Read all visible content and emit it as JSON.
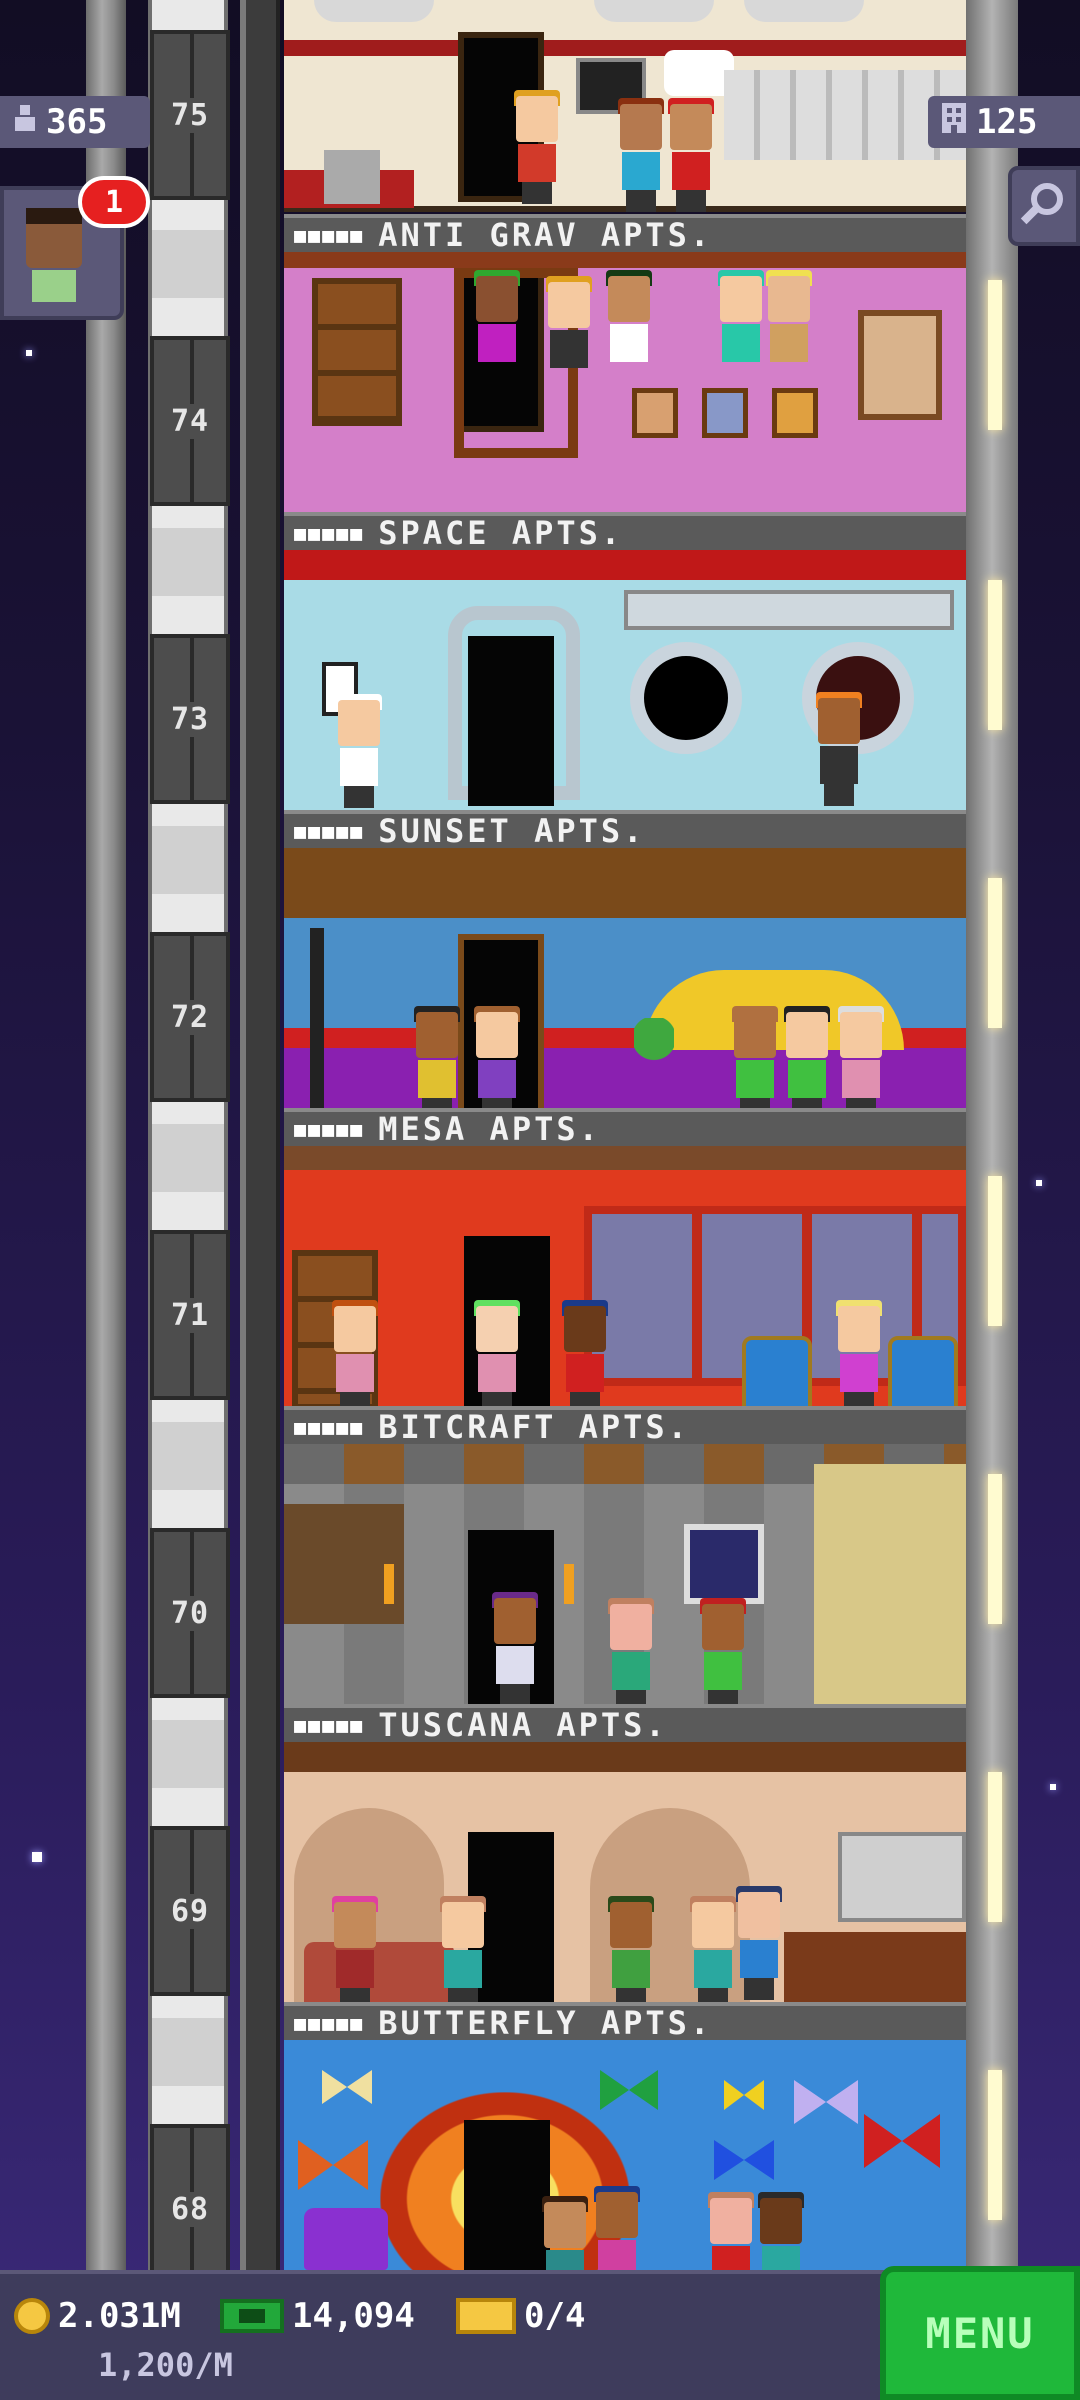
{
  "hud": {
    "population": "365",
    "current_floor": "75",
    "floor_count": "125",
    "notification_count": "1"
  },
  "floors": [
    {
      "number": "75",
      "name": "",
      "stars": ""
    },
    {
      "number": "74",
      "name": "ANTI GRAV APTS.",
      "stars": "■■■■■"
    },
    {
      "number": "73",
      "name": "SPACE APTS.",
      "stars": "■■■■■"
    },
    {
      "number": "72",
      "name": "SUNSET APTS.",
      "stars": "■■■■■"
    },
    {
      "number": "71",
      "name": "MESA APTS.",
      "stars": "■■■■■"
    },
    {
      "number": "70",
      "name": "BITCRAFT APTS.",
      "stars": "■■■■■"
    },
    {
      "number": "69",
      "name": "TUSCANA APTS.",
      "stars": "■■■■■"
    },
    {
      "number": "68",
      "name": "BUTTERFLY APTS.",
      "stars": "■■■■■"
    }
  ],
  "bottom_bar": {
    "coins": "2.031M",
    "coins_rate": "1,200/M",
    "bux": "14,094",
    "tickets": "0/4",
    "menu_label": "MENU"
  },
  "icons": {
    "population": "person-icon",
    "floors": "building-icon",
    "search": "magnifier-icon",
    "coin": "coin-icon",
    "bux": "bux-icon",
    "ticket": "ticket-icon"
  },
  "colors": {
    "menu": "#1fb83a",
    "badge": "#e62020",
    "hud_panel": "#5b5878"
  }
}
